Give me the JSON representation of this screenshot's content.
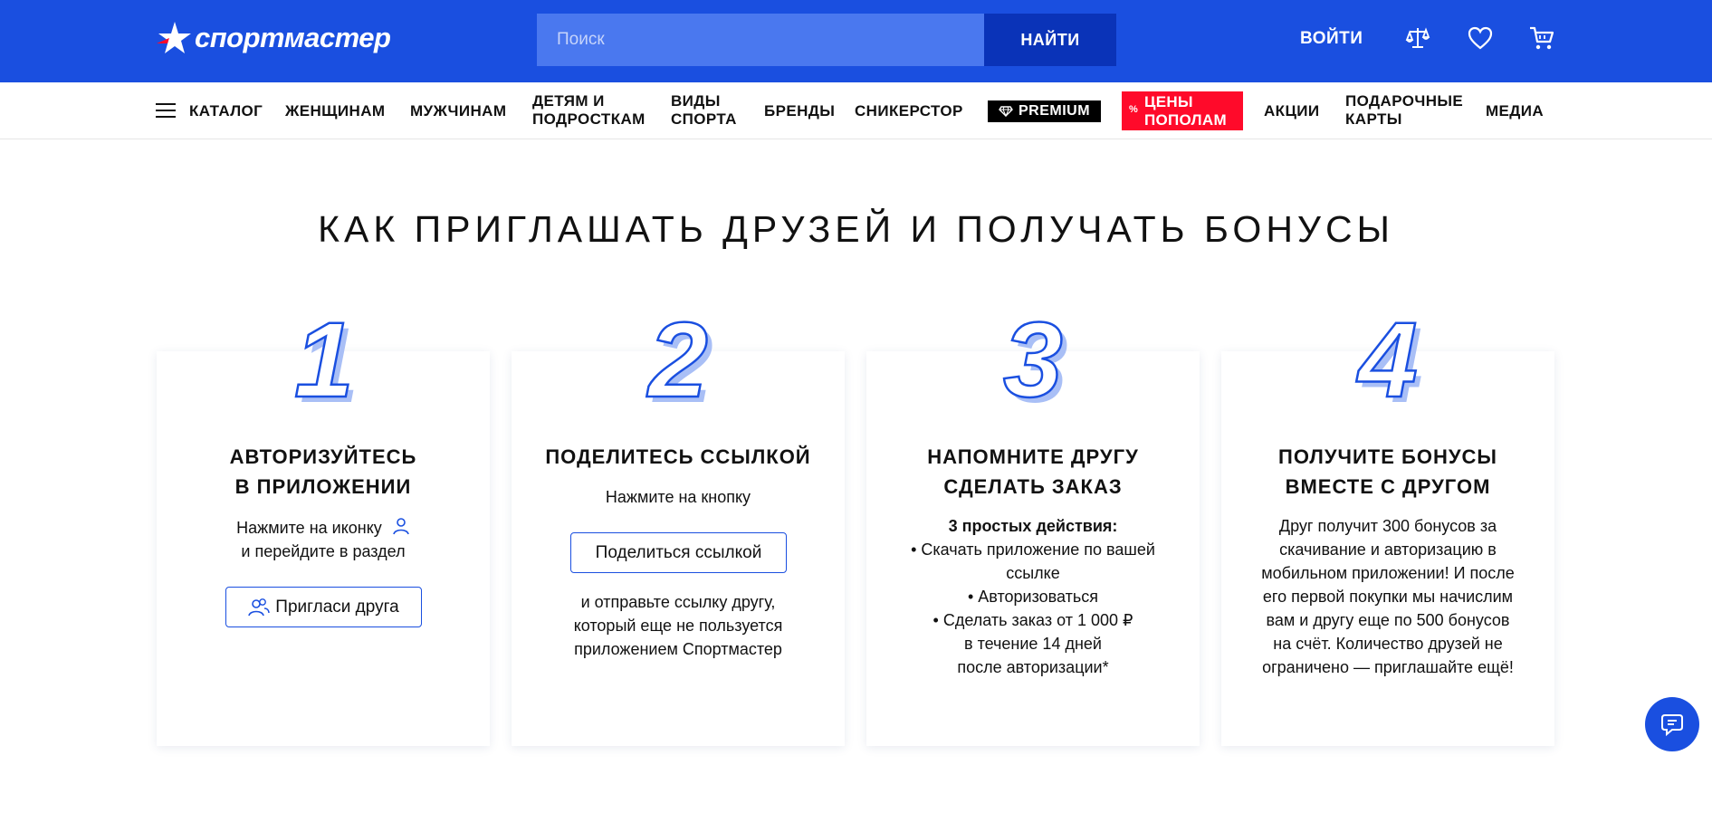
{
  "header": {
    "logo_text": "спортмастер",
    "search_placeholder": "Поиск",
    "search_button": "НАЙТИ",
    "login": "ВОЙТИ",
    "icons": [
      "compare-icon",
      "heart-icon",
      "cart-icon"
    ]
  },
  "nav": {
    "catalog": "КАТАЛОГ",
    "women": "ЖЕНЩИНАМ",
    "men": "МУЖЧИНАМ",
    "kids_l1": "ДЕТЯМ И",
    "kids_l2": "ПОДРОСТКАМ",
    "sports_l1": "ВИДЫ",
    "sports_l2": "СПОРТА",
    "brands": "БРЕНДЫ",
    "sneakerstore": "СНИКЕРСТОР",
    "premium": "PREMIUM",
    "sale_pct": "%",
    "sale_l1": "ЦЕНЫ",
    "sale_l2": "ПОПОЛАМ",
    "promos": "АКЦИИ",
    "gift_l1": "ПОДАРОЧНЫЕ",
    "gift_l2": "КАРТЫ",
    "media": "МЕДИА"
  },
  "page": {
    "title": "КАК ПРИГЛАШАТЬ ДРУЗЕЙ И ПОЛУЧАТЬ БОНУСЫ"
  },
  "steps": [
    {
      "number": "1",
      "title_l1": "АВТОРИЗУЙТЕСЬ",
      "title_l2": "В ПРИЛОЖЕНИИ",
      "text_l1": "Нажмите на иконку",
      "text_l2": "и перейдите в раздел",
      "button": "Пригласи друга"
    },
    {
      "number": "2",
      "title_l1": "ПОДЕЛИТЕСЬ ССЫЛКОЙ",
      "text_top": "Нажмите на кнопку",
      "button": "Поделиться ссылкой",
      "text_l1": "и отправьте ссылку другу,",
      "text_l2": "который еще не пользуется",
      "text_l3": "приложением Спортмастер"
    },
    {
      "number": "3",
      "title_l1": "НАПОМНИТЕ ДРУГУ",
      "title_l2": "СДЕЛАТЬ ЗАКАЗ",
      "lead": "3 простых действия:",
      "lines": [
        "• Скачать приложение по вашей",
        "ссылке",
        "• Авторизоваться",
        "• Сделать заказ от 1 000 ₽",
        "в течение 14 дней",
        "после авторизации*"
      ]
    },
    {
      "number": "4",
      "title_l1": "ПОЛУЧИТЕ БОНУСЫ",
      "title_l2": "ВМЕСТЕ С ДРУГОМ",
      "lines": [
        "Друг получит 300 бонусов за",
        "скачивание и авторизацию в",
        "мобильном приложении! И после",
        "его первой покупки мы начислим",
        "вам и другу еще по 500 бонусов",
        "на счёт. Количество друзей не",
        "ограничено — приглашайте ещё!"
      ]
    }
  ],
  "colors": {
    "brand_blue": "#1a4fe0",
    "search_bg": "#4a78ef",
    "search_btn": "#0a33b8",
    "sale_red": "#ff0a2a",
    "number_fill": "#a9bff6"
  }
}
